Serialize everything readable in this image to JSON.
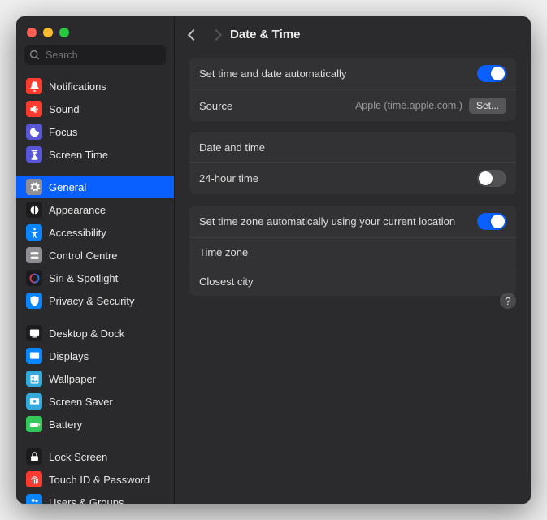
{
  "search": {
    "placeholder": "Search"
  },
  "sidebar": {
    "items": [
      {
        "label": "Notifications",
        "bg": "#ff3b30"
      },
      {
        "label": "Sound",
        "bg": "#ff3b30"
      },
      {
        "label": "Focus",
        "bg": "#5856d6"
      },
      {
        "label": "Screen Time",
        "bg": "#5856d6"
      }
    ],
    "items2": [
      {
        "label": "General",
        "bg": "#8e8e93"
      },
      {
        "label": "Appearance",
        "bg": "#1c1c1e"
      },
      {
        "label": "Accessibility",
        "bg": "#0a84ff"
      },
      {
        "label": "Control Centre",
        "bg": "#8e8e93"
      },
      {
        "label": "Siri & Spotlight",
        "bg": "#1c1c1e"
      },
      {
        "label": "Privacy & Security",
        "bg": "#0a84ff"
      }
    ],
    "items3": [
      {
        "label": "Desktop & Dock",
        "bg": "#1c1c1e"
      },
      {
        "label": "Displays",
        "bg": "#0a84ff"
      },
      {
        "label": "Wallpaper",
        "bg": "#34aadc"
      },
      {
        "label": "Screen Saver",
        "bg": "#34aadc"
      },
      {
        "label": "Battery",
        "bg": "#34c759"
      }
    ],
    "items4": [
      {
        "label": "Lock Screen",
        "bg": "#1c1c1e"
      },
      {
        "label": "Touch ID & Password",
        "bg": "#ff3b30"
      },
      {
        "label": "Users & Groups",
        "bg": "#0a84ff"
      }
    ]
  },
  "header": {
    "title": "Date & Time"
  },
  "panel": {
    "auto_time_label": "Set time and date automatically",
    "auto_time_on": true,
    "source_label": "Source",
    "source_value": "Apple (time.apple.com.)",
    "source_btn": "Set...",
    "datetime_label": "Date and time",
    "datetime_value": "",
    "h24_label": "24-hour time",
    "h24_on": false,
    "auto_tz_label": "Set time zone automatically using your current location",
    "auto_tz_on": true,
    "tz_label": "Time zone",
    "tz_value": "",
    "city_label": "Closest city",
    "city_value": ""
  },
  "help": "?"
}
